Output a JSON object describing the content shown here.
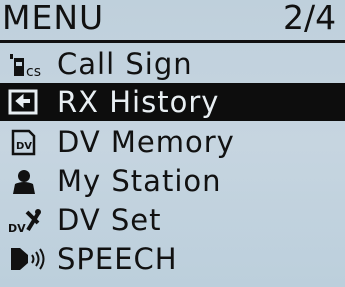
{
  "header": {
    "title": "MENU",
    "page_indicator": "2/4"
  },
  "menu": {
    "selected_index": 1,
    "items": [
      {
        "label": "Call Sign",
        "icon": "call-sign-icon",
        "icon_text": "cs"
      },
      {
        "label": "RX History",
        "icon": "rx-history-icon"
      },
      {
        "label": "DV Memory",
        "icon": "dv-memory-icon",
        "icon_text": "DV"
      },
      {
        "label": "My Station",
        "icon": "my-station-icon"
      },
      {
        "label": "DV Set",
        "icon": "dv-set-icon",
        "icon_text": "DV"
      },
      {
        "label": "SPEECH",
        "icon": "speech-icon"
      }
    ]
  }
}
